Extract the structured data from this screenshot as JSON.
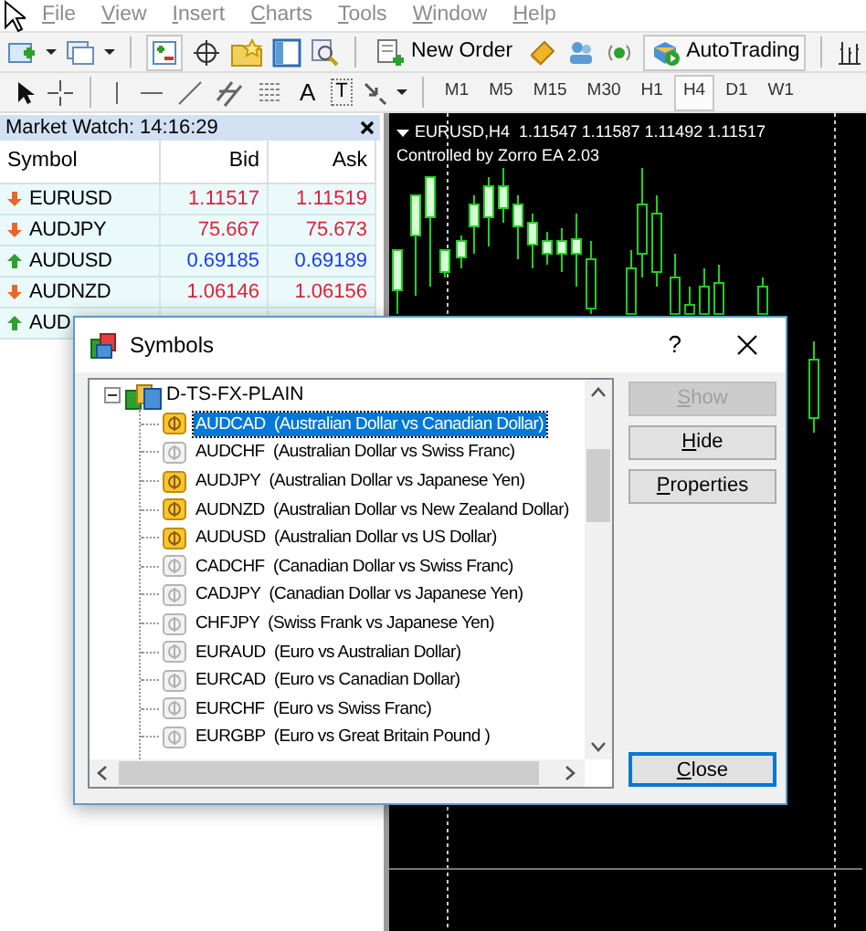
{
  "menu": [
    {
      "label": "File"
    },
    {
      "label": "View"
    },
    {
      "label": "Insert"
    },
    {
      "label": "Charts"
    },
    {
      "label": "Tools"
    },
    {
      "label": "Window"
    },
    {
      "label": "Help"
    }
  ],
  "toolbar": {
    "new_order": "New Order",
    "auto_trading": "AutoTrading",
    "text_tool": "A",
    "label_tool": "T"
  },
  "timeframes": [
    {
      "label": "M1",
      "selected": false
    },
    {
      "label": "M5",
      "selected": false
    },
    {
      "label": "M15",
      "selected": false
    },
    {
      "label": "M30",
      "selected": false
    },
    {
      "label": "H1",
      "selected": false
    },
    {
      "label": "H4",
      "selected": true
    },
    {
      "label": "D1",
      "selected": false
    },
    {
      "label": "W1",
      "selected": false
    }
  ],
  "market_watch": {
    "title": "Market Watch: 14:16:29",
    "columns": [
      "Symbol",
      "Bid",
      "Ask"
    ],
    "rows": [
      {
        "symbol": "EURUSD",
        "bid": "1.11517",
        "ask": "1.11519",
        "rising": false
      },
      {
        "symbol": "AUDJPY",
        "bid": "75.667",
        "ask": "75.673",
        "rising": false
      },
      {
        "symbol": "AUDUSD",
        "bid": "0.69185",
        "ask": "0.69189",
        "rising": true
      },
      {
        "symbol": "AUDNZD",
        "bid": "1.06146",
        "ask": "1.06156",
        "rising": false
      },
      {
        "symbol": "AUD",
        "rising": true
      }
    ]
  },
  "chart": {
    "title": "EURUSD,H4  1.11547 1.11587 1.11492 1.11517",
    "subtitle": "Controlled by Zorro EA 2.03"
  },
  "dialog": {
    "title": "Symbols",
    "help": "?",
    "tree": {
      "label": "D-TS-FX-PLAIN",
      "expanded": true,
      "children": [
        {
          "label": "AUDCAD  (Australian Dollar vs Canadian Dollar)",
          "shown": true,
          "selected": true
        },
        {
          "label": "AUDCHF  (Australian Dollar vs Swiss Franc)",
          "shown": false,
          "selected": false
        },
        {
          "label": "AUDJPY  (Australian Dollar vs Japanese Yen)",
          "shown": true,
          "selected": false
        },
        {
          "label": "AUDNZD  (Australian Dollar vs New Zealand Dollar)",
          "shown": true,
          "selected": false
        },
        {
          "label": "AUDUSD  (Australian Dollar vs US Dollar)",
          "shown": true,
          "selected": false
        },
        {
          "label": "CADCHF  (Canadian Dollar vs Swiss Franc)",
          "shown": false,
          "selected": false
        },
        {
          "label": "CADJPY  (Canadian Dollar vs Japanese Yen)",
          "shown": false,
          "selected": false
        },
        {
          "label": "CHFJPY  (Swiss Frank vs Japanese Yen)",
          "shown": false,
          "selected": false
        },
        {
          "label": "EURAUD  (Euro vs Australian Dollar)",
          "shown": false,
          "selected": false
        },
        {
          "label": "EURCAD  (Euro vs Canadian Dollar)",
          "shown": false,
          "selected": false
        },
        {
          "label": "EURCHF  (Euro vs Swiss Franc)",
          "shown": false,
          "selected": false
        },
        {
          "label": "EURGBP  (Euro vs Great Britain Pound )",
          "shown": false,
          "selected": false
        }
      ]
    },
    "buttons": [
      {
        "label": "Show",
        "disabled": true
      },
      {
        "label": "Hide",
        "disabled": false
      },
      {
        "label": "Properties",
        "disabled": false
      }
    ],
    "close_button": {
      "label": "Close",
      "focused": true
    }
  }
}
